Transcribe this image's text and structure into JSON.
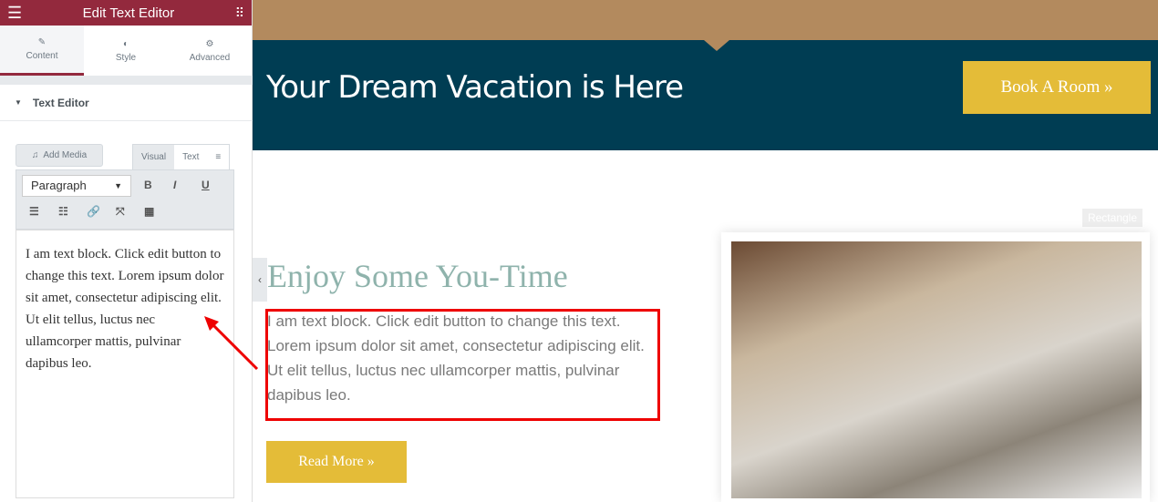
{
  "panel": {
    "title": "Edit Text Editor",
    "tabs": [
      {
        "label": "Content",
        "icon": "pencil-icon"
      },
      {
        "label": "Style",
        "icon": "half-circle-icon"
      },
      {
        "label": "Advanced",
        "icon": "gear-icon"
      }
    ],
    "section": "Text Editor",
    "add_media": "Add Media",
    "visual": "Visual",
    "text": "Text",
    "format": "Paragraph",
    "content": "I am text block. Click edit button to change this text. Lorem ipsum dolor sit amet, consectetur adipiscing elit. Ut elit tellus, luctus nec ullamcorper mattis, pulvinar dapibus leo."
  },
  "page": {
    "banner_title": "Your Dream Vacation is Here",
    "book_button": "Book A Room »",
    "heading": "Enjoy Some You-Time",
    "body": "I am text block. Click edit button to change this text. Lorem ipsum dolor sit amet, consectetur adipiscing elit. Ut elit tellus, luctus nec ullamcorper mattis, pulvinar dapibus leo.",
    "read_more": "Read More »",
    "rect_label": "Rectangle"
  },
  "colors": {
    "accent": "#93293d",
    "banner": "#003d53",
    "button": "#e4bc38",
    "annotation": "#ee0000"
  }
}
